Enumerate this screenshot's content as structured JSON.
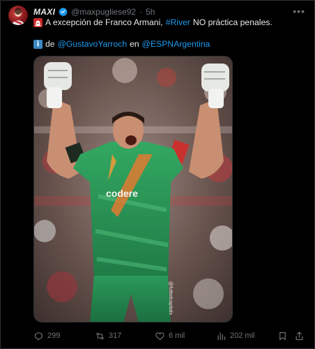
{
  "author": {
    "name": "MAXI",
    "handle": "@maxpugliese92",
    "separator": "·",
    "time": "5h",
    "verified": true
  },
  "tweet": {
    "line1": {
      "emoji": "siren-emoji",
      "text_before": "A excepción de Franco Armani,",
      "hashtag": "#River",
      "text_after": "NO práctica penales."
    },
    "line2": {
      "emoji": "information-emoji",
      "prefix": "de",
      "mention1": "@GustavoYarroch",
      "middle": "en",
      "mention2": "@ESPNArgentina"
    }
  },
  "media": {
    "description": "goalkeeper-celebrating-photo",
    "jersey_text": "codere",
    "watermark": "@futbolcapitals"
  },
  "actions": {
    "replies": "299",
    "reposts": "317",
    "likes": "6 mil",
    "views": "202 mil"
  },
  "colors": {
    "background": "#000000",
    "text": "#e7e9ea",
    "muted": "#71767b",
    "link": "#1d9bf0",
    "jersey": "#2f9b5a"
  }
}
